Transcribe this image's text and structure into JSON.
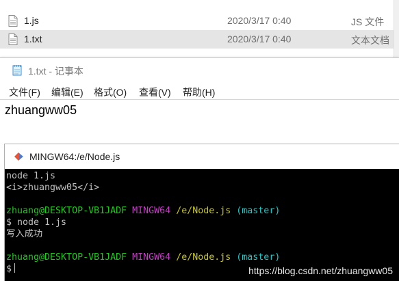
{
  "explorer": {
    "rows": [
      {
        "name": "1.js",
        "date": "2020/3/17 0:40",
        "type": "JS 文件"
      },
      {
        "name": "1.txt",
        "date": "2020/3/17 0:40",
        "type": "文本文档"
      }
    ]
  },
  "notepad": {
    "title": "1.txt - 记事本",
    "menu": [
      "文件(F)",
      "编辑(E)",
      "格式(O)",
      "查看(V)",
      "帮助(H)"
    ],
    "content": "zhuangww05"
  },
  "terminal": {
    "title": "MINGW64:/e/Node.js",
    "lines": {
      "l1": "node 1.js",
      "l2": "<i>zhuangww05</i>",
      "p1_user": "zhuang@DESKTOP-VB1JADF",
      "p1_env": "MINGW64",
      "p1_path": "/e/Node.js",
      "p1_branch": "(master)",
      "l3": "$ node 1.js",
      "l4": "写入成功",
      "p2_user": "zhuang@DESKTOP-VB1JADF",
      "p2_env": "MINGW64",
      "p2_path": "/e/Node.js",
      "p2_branch": "(master)",
      "prompt": "$"
    },
    "watermark": "https://blog.csdn.net/zhuangww05"
  },
  "colors": {
    "user": "#1ec81e",
    "env": "#bf40bf",
    "path": "#c8c81e",
    "branch": "#1ec8c8"
  }
}
